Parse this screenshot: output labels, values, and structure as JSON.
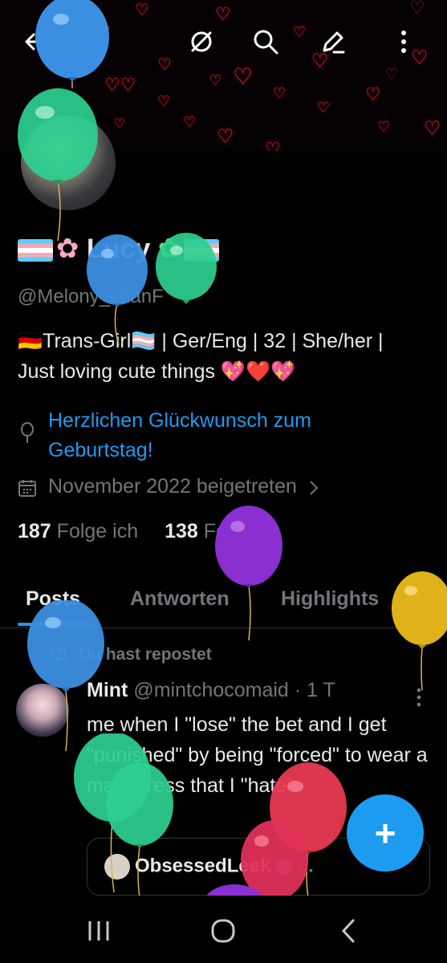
{
  "topbar": {
    "back_icon": "arrow-left-icon",
    "grok_icon": "slashed-circle-icon",
    "search_icon": "search-icon",
    "compose_icon": "edit-pencil-icon",
    "more_icon": "more-vertical-icon"
  },
  "profile": {
    "display_name": "Lucy",
    "handle": "@Melony_chanF",
    "bio_line1": "🇩🇪Trans-Girl🏳️‍⚧️ | Ger/Eng | 32 | She/her |",
    "bio_line2": "Just loving cute things 💖❤️💖",
    "birthday_line1": "Herzlichen Glückwunsch zum",
    "birthday_line2": "Geburtstag!",
    "joined": "November 2022 beigetreten",
    "following_count": "187",
    "following_label": "Folge ich",
    "followers_count": "138",
    "followers_label": "Follower"
  },
  "tabs": [
    {
      "label": "Posts"
    },
    {
      "label": "Antworten"
    },
    {
      "label": "Highlights"
    },
    {
      "label": "A"
    }
  ],
  "post": {
    "repost_label": "Du hast repostet",
    "author": "Mint",
    "author_handle": "@mintchocomaid",
    "time": "· 1 T",
    "text": "me when I \"lose\" the bet and I get \"punished\" by being \"forced\" to wear a maid dress that I \"hate\"",
    "quoted_author": "ObsessedLeek",
    "quoted_more": "..."
  },
  "fab": {
    "label": "+"
  },
  "colors": {
    "accent": "#1d9bf0",
    "text": "#e7e9ea",
    "muted": "#71767b",
    "background": "#000000",
    "heart": "#ff2a3d"
  }
}
